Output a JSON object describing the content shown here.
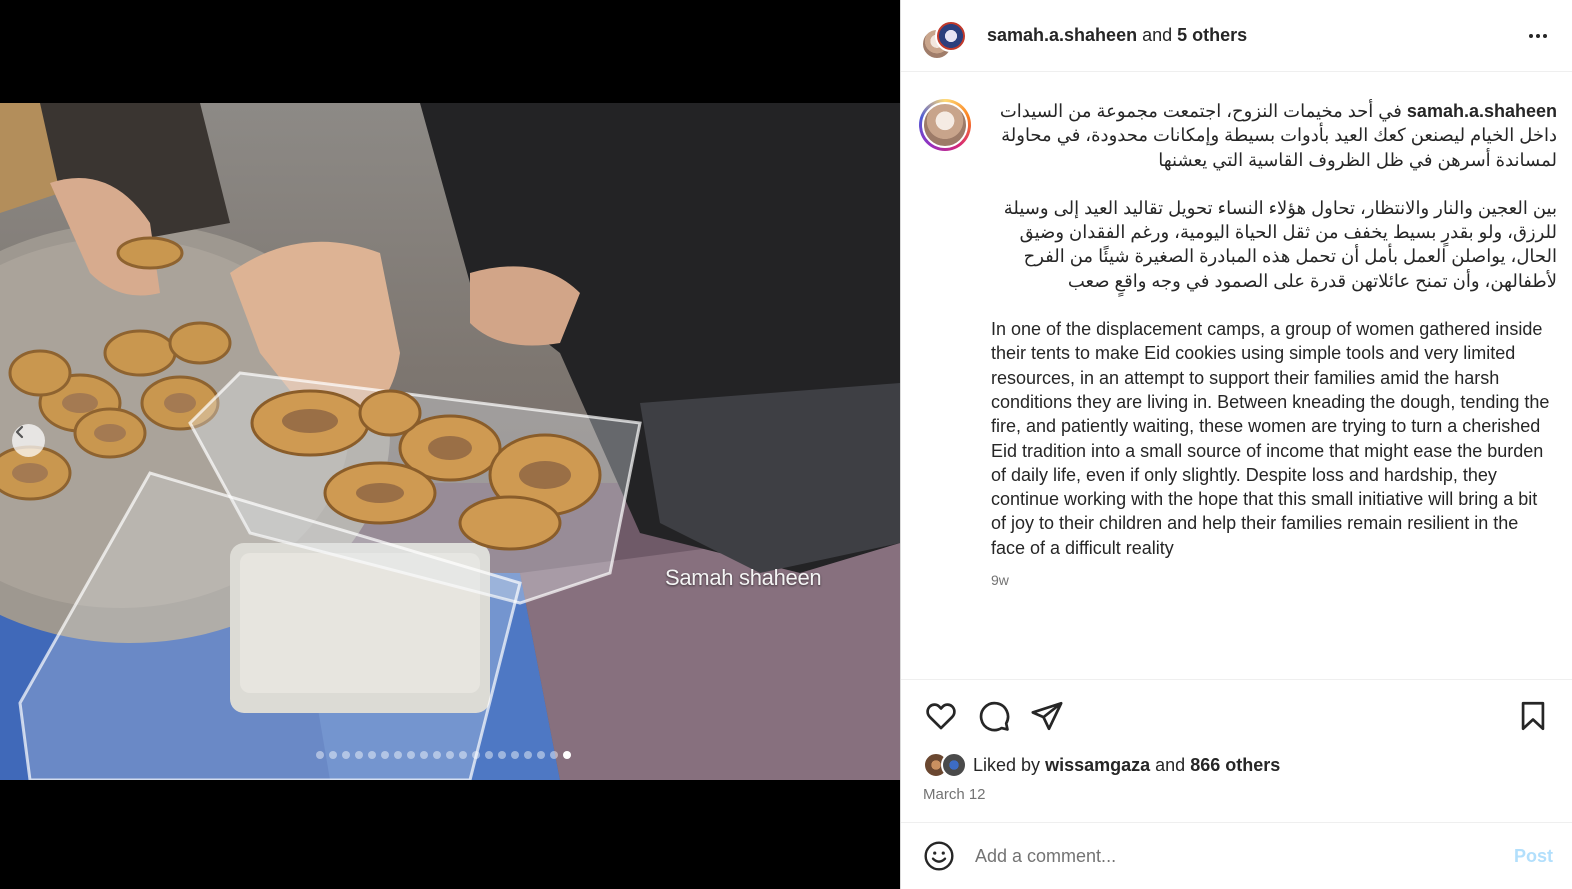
{
  "media": {
    "watermark": "Samah shaheen",
    "carousel_total": 20,
    "carousel_active_index": 19
  },
  "header": {
    "username": "samah.a.shaheen",
    "joiner": "and",
    "others": "5 others",
    "more_icon": "more-horizontal-icon"
  },
  "caption": {
    "username": "samah.a.shaheen",
    "arabic_para1": "في أحد مخيمات النزوح، اجتمعت مجموعة من السيدات داخل الخيام ليصنعن كعك العيد بأدوات بسيطة وإمكانات محدودة، في محاولة لمساندة أسرهن في ظل الظروف القاسية التي يعشنها",
    "arabic_para2": "بين العجين والنار والانتظار، تحاول هؤلاء النساء تحويل تقاليد العيد إلى وسيلة للرزق، ولو بقدرٍ بسيط يخفف من ثقل الحياة اليومية، ورغم الفقدان وضيق الحال، يواصلن العمل بأمل أن تحمل هذه المبادرة الصغيرة شيئًا من الفرح لأطفالهن، وأن تمنح عائلاتهن قدرة على الصمود في وجه واقعٍ صعب",
    "english": "In one of the displacement camps, a group of women gathered inside their tents to make Eid cookies using simple tools and very limited resources, in an attempt to support their families amid the harsh conditions they are living in. Between kneading the dough, tending the fire, and patiently waiting, these women are trying to turn a cherished Eid tradition into a small source of income that might ease the burden of daily life, even if only slightly. Despite loss and hardship, they continue working with the hope that this small initiative will bring a bit of joy to their children and help their families remain resilient in the face of a difficult reality",
    "time_ago": "9w"
  },
  "actions": {
    "like_icon": "heart-icon",
    "comment_icon": "comment-icon",
    "share_icon": "send-icon",
    "save_icon": "bookmark-icon",
    "liked_by_prefix": "Liked by",
    "liked_by_user": "wissamgaza",
    "liked_by_and": "and",
    "liked_by_others": "866 others",
    "date": "March 12"
  },
  "comment_box": {
    "placeholder": "Add a comment...",
    "post_label": "Post",
    "emoji_icon": "emoji-icon"
  },
  "colors": {
    "link_disabled": "#b2dffc",
    "secondary_text": "#737373",
    "primary_text": "#262626"
  }
}
